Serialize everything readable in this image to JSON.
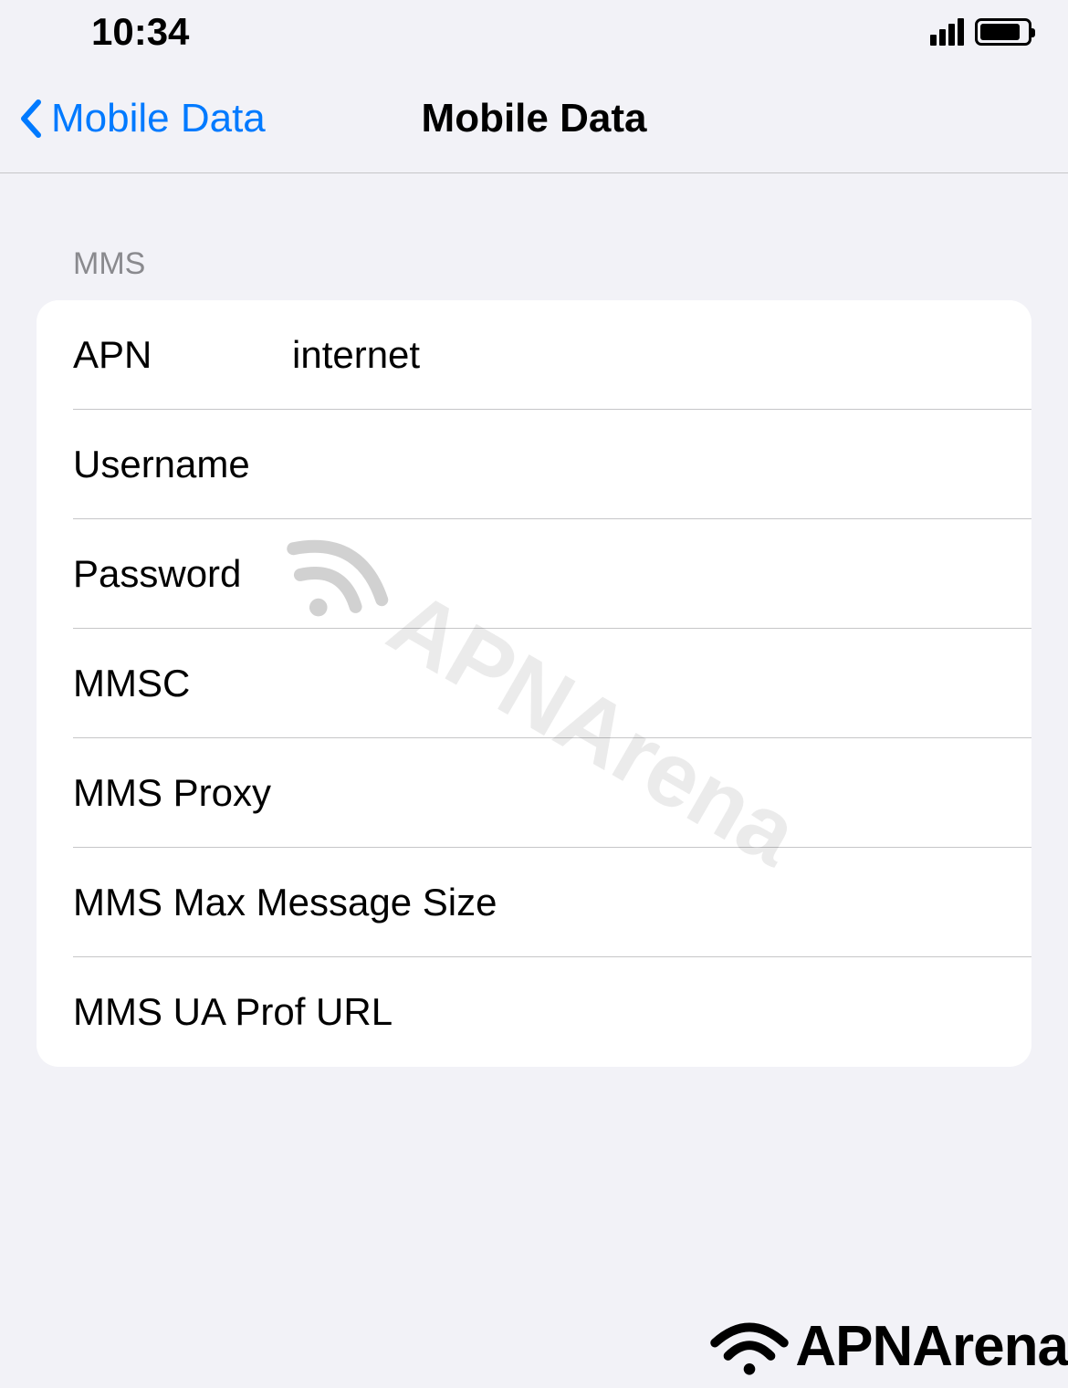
{
  "statusBar": {
    "time": "10:34"
  },
  "nav": {
    "backLabel": "Mobile Data",
    "title": "Mobile Data"
  },
  "section": {
    "header": "MMS"
  },
  "fields": {
    "apn": {
      "label": "APN",
      "value": "internet"
    },
    "username": {
      "label": "Username",
      "value": ""
    },
    "password": {
      "label": "Password",
      "value": ""
    },
    "mmsc": {
      "label": "MMSC",
      "value": ""
    },
    "mmsProxy": {
      "label": "MMS Proxy",
      "value": ""
    },
    "mmsMaxSize": {
      "label": "MMS Max Message Size",
      "value": ""
    },
    "mmsUaProf": {
      "label": "MMS UA Prof URL",
      "value": ""
    }
  },
  "watermark": {
    "text": "APNArena"
  },
  "footer": {
    "brand": "APNArena"
  }
}
